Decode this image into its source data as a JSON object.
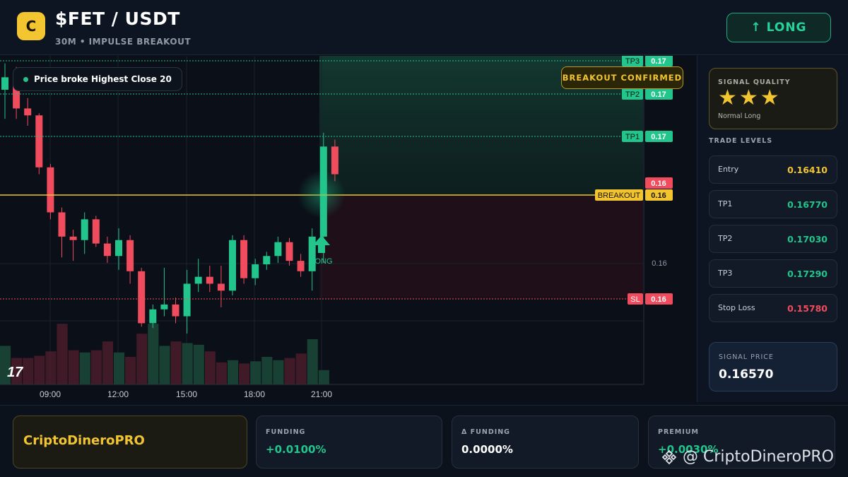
{
  "header": {
    "logo_letter": "C",
    "pair": "$FET / USDT",
    "subtitle": "30M • IMPULSE BREAKOUT",
    "direction_button": "↑ LONG"
  },
  "chart": {
    "info_pill": "Price broke Highest Close 20",
    "banner": "BREAKOUT CONFIRMED",
    "signal_marker": "LONG",
    "tv_logo": "17",
    "level_tags": {
      "tp3": {
        "tag": "TP3",
        "value": "0.17"
      },
      "tp2": {
        "tag": "TP2",
        "value": "0.17"
      },
      "tp1": {
        "tag": "TP1",
        "value": "0.17"
      },
      "last": {
        "value": "0.16"
      },
      "breakout": {
        "tag": "BREAKOUT",
        "value": "0.16"
      },
      "axis": {
        "value": "0.16"
      },
      "sl": {
        "tag": "SL",
        "value": "0.16"
      }
    },
    "time_labels": [
      "09:00",
      "12:00",
      "15:00",
      "18:00",
      "21:00"
    ],
    "colors": {
      "up": "#22c58b",
      "down": "#f14b5e",
      "breakout": "#f2c530",
      "tp": "#22c58b",
      "sl": "#f14b5e"
    }
  },
  "chart_data": {
    "type": "candlestick",
    "x": [
      "07:30",
      "08:00",
      "08:30",
      "09:00",
      "09:30",
      "10:00",
      "10:30",
      "11:00",
      "11:30",
      "12:00",
      "12:30",
      "13:00",
      "13:30",
      "14:00",
      "14:30",
      "15:00",
      "15:30",
      "16:00",
      "16:30",
      "17:00",
      "17:30",
      "18:00",
      "18:30",
      "19:00",
      "19:30",
      "20:00",
      "20:30",
      "21:00",
      "21:30"
    ],
    "candles": [
      {
        "o": 0.16562,
        "h": 0.166,
        "l": 0.1652,
        "c": 0.1658
      },
      {
        "o": 0.1658,
        "h": 0.16595,
        "l": 0.1652,
        "c": 0.16535
      },
      {
        "o": 0.16535,
        "h": 0.1655,
        "l": 0.1651,
        "c": 0.16525
      },
      {
        "o": 0.16525,
        "h": 0.16528,
        "l": 0.1644,
        "c": 0.1645
      },
      {
        "o": 0.1645,
        "h": 0.16455,
        "l": 0.16375,
        "c": 0.16385
      },
      {
        "o": 0.16385,
        "h": 0.16392,
        "l": 0.1632,
        "c": 0.1635
      },
      {
        "o": 0.1635,
        "h": 0.1636,
        "l": 0.16315,
        "c": 0.16345
      },
      {
        "o": 0.16345,
        "h": 0.16385,
        "l": 0.16325,
        "c": 0.16375
      },
      {
        "o": 0.16375,
        "h": 0.1638,
        "l": 0.16335,
        "c": 0.1634
      },
      {
        "o": 0.1634,
        "h": 0.1635,
        "l": 0.16312,
        "c": 0.16322
      },
      {
        "o": 0.16322,
        "h": 0.16362,
        "l": 0.16302,
        "c": 0.16345
      },
      {
        "o": 0.16345,
        "h": 0.16352,
        "l": 0.16282,
        "c": 0.163
      },
      {
        "o": 0.163,
        "h": 0.16305,
        "l": 0.1622,
        "c": 0.16225
      },
      {
        "o": 0.16225,
        "h": 0.16252,
        "l": 0.16218,
        "c": 0.16245
      },
      {
        "o": 0.16245,
        "h": 0.16305,
        "l": 0.16235,
        "c": 0.16252
      },
      {
        "o": 0.16252,
        "h": 0.16262,
        "l": 0.16225,
        "c": 0.16235
      },
      {
        "o": 0.16235,
        "h": 0.16302,
        "l": 0.1621,
        "c": 0.16282
      },
      {
        "o": 0.16282,
        "h": 0.16318,
        "l": 0.1627,
        "c": 0.16292
      },
      {
        "o": 0.16292,
        "h": 0.16308,
        "l": 0.1627,
        "c": 0.16282
      },
      {
        "o": 0.16282,
        "h": 0.16308,
        "l": 0.16248,
        "c": 0.16272
      },
      {
        "o": 0.16272,
        "h": 0.16352,
        "l": 0.16265,
        "c": 0.16345
      },
      {
        "o": 0.16345,
        "h": 0.16352,
        "l": 0.16282,
        "c": 0.1629
      },
      {
        "o": 0.1629,
        "h": 0.16318,
        "l": 0.1628,
        "c": 0.1631
      },
      {
        "o": 0.1631,
        "h": 0.16328,
        "l": 0.16302,
        "c": 0.16322
      },
      {
        "o": 0.16322,
        "h": 0.1635,
        "l": 0.16312,
        "c": 0.16342
      },
      {
        "o": 0.16342,
        "h": 0.16348,
        "l": 0.16308,
        "c": 0.16315
      },
      {
        "o": 0.16315,
        "h": 0.16325,
        "l": 0.16292,
        "c": 0.163
      },
      {
        "o": 0.163,
        "h": 0.16362,
        "l": 0.16272,
        "c": 0.1635
      },
      {
        "o": 0.1635,
        "h": 0.165,
        "l": 0.16312,
        "c": 0.1648
      },
      {
        "o": 0.1648,
        "h": 0.1649,
        "l": 0.1643,
        "c": 0.1644
      }
    ],
    "volumes": [
      70,
      48,
      48,
      52,
      60,
      110,
      62,
      58,
      62,
      78,
      58,
      50,
      92,
      110,
      70,
      78,
      75,
      72,
      60,
      40,
      44,
      38,
      42,
      50,
      44,
      48,
      56,
      82,
      26,
      0
    ],
    "levels": {
      "entry": 0.1641,
      "tp1": 0.1677,
      "tp2": 0.1703,
      "tp3": 0.1729,
      "sl": 0.1578
    },
    "xlabel": "",
    "ylabel": ""
  },
  "panel": {
    "quality_label": "SIGNAL QUALITY",
    "stars": "★★★",
    "quality_note": "Normal Long",
    "levels_title": "TRADE LEVELS",
    "levels": [
      {
        "name": "Entry",
        "value": "0.16410",
        "color": "#f2c530"
      },
      {
        "name": "TP1",
        "value": "0.16770",
        "color": "#22c58b"
      },
      {
        "name": "TP2",
        "value": "0.17030",
        "color": "#22c58b"
      },
      {
        "name": "TP3",
        "value": "0.17290",
        "color": "#22c58b"
      },
      {
        "name": "Stop Loss",
        "value": "0.15780",
        "color": "#f14b5e"
      }
    ],
    "signal_price_label": "SIGNAL PRICE",
    "signal_price": "0.16570"
  },
  "bottom": {
    "brand": "CriptoDineroPRO",
    "stats": [
      {
        "label": "FUNDING",
        "value": "+0.0100%",
        "color": "#22c58b"
      },
      {
        "label": "Δ FUNDING",
        "value": "0.0000%",
        "color": "#ffffff"
      },
      {
        "label": "PREMIUM",
        "value": "+0.0030%",
        "color": "#22c58b"
      }
    ],
    "watermark": "@ CriptoDineroPRO"
  }
}
